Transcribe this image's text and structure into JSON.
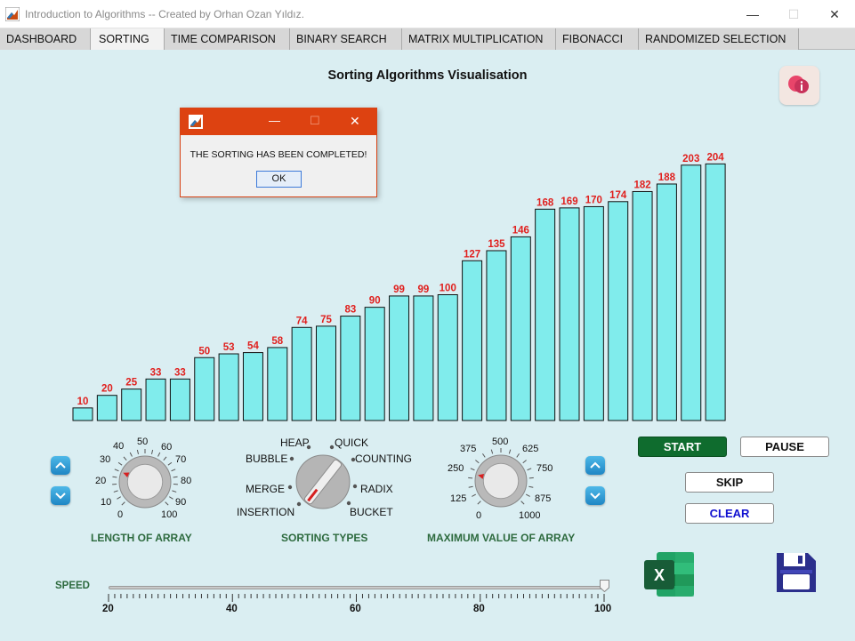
{
  "window": {
    "title": "Introduction to Algorithms -- Created by Orhan Ozan Yıldız.",
    "minimize": "—",
    "maximize": "☐",
    "close": "✕"
  },
  "tabs": [
    {
      "label": "DASHBOARD"
    },
    {
      "label": "SORTING"
    },
    {
      "label": "TIME COMPARISON"
    },
    {
      "label": "BINARY SEARCH"
    },
    {
      "label": "MATRIX MULTIPLICATION"
    },
    {
      "label": "FIBONACCI"
    },
    {
      "label": "RANDOMIZED SELECTION"
    }
  ],
  "active_tab": "SORTING",
  "chart_title": "Sorting Algorithms Visualisation",
  "chart_data": {
    "type": "bar",
    "values": [
      10,
      20,
      25,
      33,
      33,
      50,
      53,
      54,
      58,
      74,
      75,
      83,
      90,
      99,
      99,
      100,
      127,
      135,
      146,
      168,
      169,
      170,
      174,
      182,
      188,
      203,
      204
    ],
    "bar_color": "#80ecec",
    "label_color": "#e0201e"
  },
  "dialog": {
    "message": "THE SORTING HAS BEEN COMPLETED!",
    "ok_label": "OK",
    "minimize": "—",
    "maximize": "☐",
    "close": "✕"
  },
  "length_knob": {
    "ticks": [
      "0",
      "10",
      "20",
      "30",
      "40",
      "50",
      "60",
      "70",
      "80",
      "90",
      "100"
    ],
    "value": 25,
    "caption": "LENGTH OF ARRAY"
  },
  "sorting_knob": {
    "options": [
      "BUBBLE",
      "HEAP",
      "QUICK",
      "COUNTING",
      "MERGE",
      "RADIX",
      "INSERTION",
      "BUCKET"
    ],
    "caption": "SORTING TYPES"
  },
  "max_knob": {
    "ticks": [
      "0",
      "125",
      "250",
      "375",
      "500",
      "625",
      "750",
      "875",
      "1000"
    ],
    "value": 220,
    "caption": "MAXIMUM VALUE OF ARRAY"
  },
  "buttons": {
    "start": "START",
    "pause": "PAUSE",
    "skip": "SKIP",
    "clear": "CLEAR"
  },
  "speed": {
    "label": "SPEED",
    "ticks": [
      "20",
      "40",
      "60",
      "80",
      "100"
    ],
    "value": 100
  },
  "icons": {
    "excel_letter": "X"
  },
  "colors": {
    "start_bg": "#0f6c2e",
    "caption_green": "#2d6a3e",
    "dialog_titlebar": "#dd4211",
    "clear_text": "#1010d0"
  }
}
